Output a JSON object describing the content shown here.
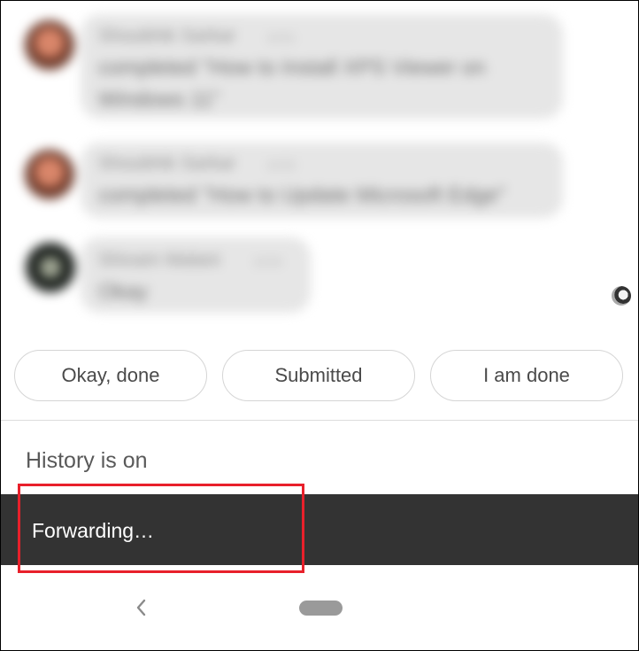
{
  "messages": [
    {
      "sender": "Shoubhik Sarkar",
      "time": "10:51",
      "body_line1": "completed \"How to Install XPS Viewer on",
      "body_line2": "Windows 11\""
    },
    {
      "sender": "Shoubhik Sarkar",
      "time": "10:53",
      "body_line1": "completed \"How to Update Microsoft Edge\""
    },
    {
      "sender": "Shivam Malani",
      "time": "10:54",
      "body_line1": "Okay"
    }
  ],
  "suggestions": [
    "Okay, done",
    "Submitted",
    "I am done"
  ],
  "history_status": "History is on",
  "snackbar": {
    "text": "Forwarding…"
  },
  "icons": {
    "back": "chevron-left-icon",
    "home": "home-pill-icon"
  },
  "colors": {
    "snackbar_bg": "#333333",
    "highlight": "#e8202b"
  }
}
